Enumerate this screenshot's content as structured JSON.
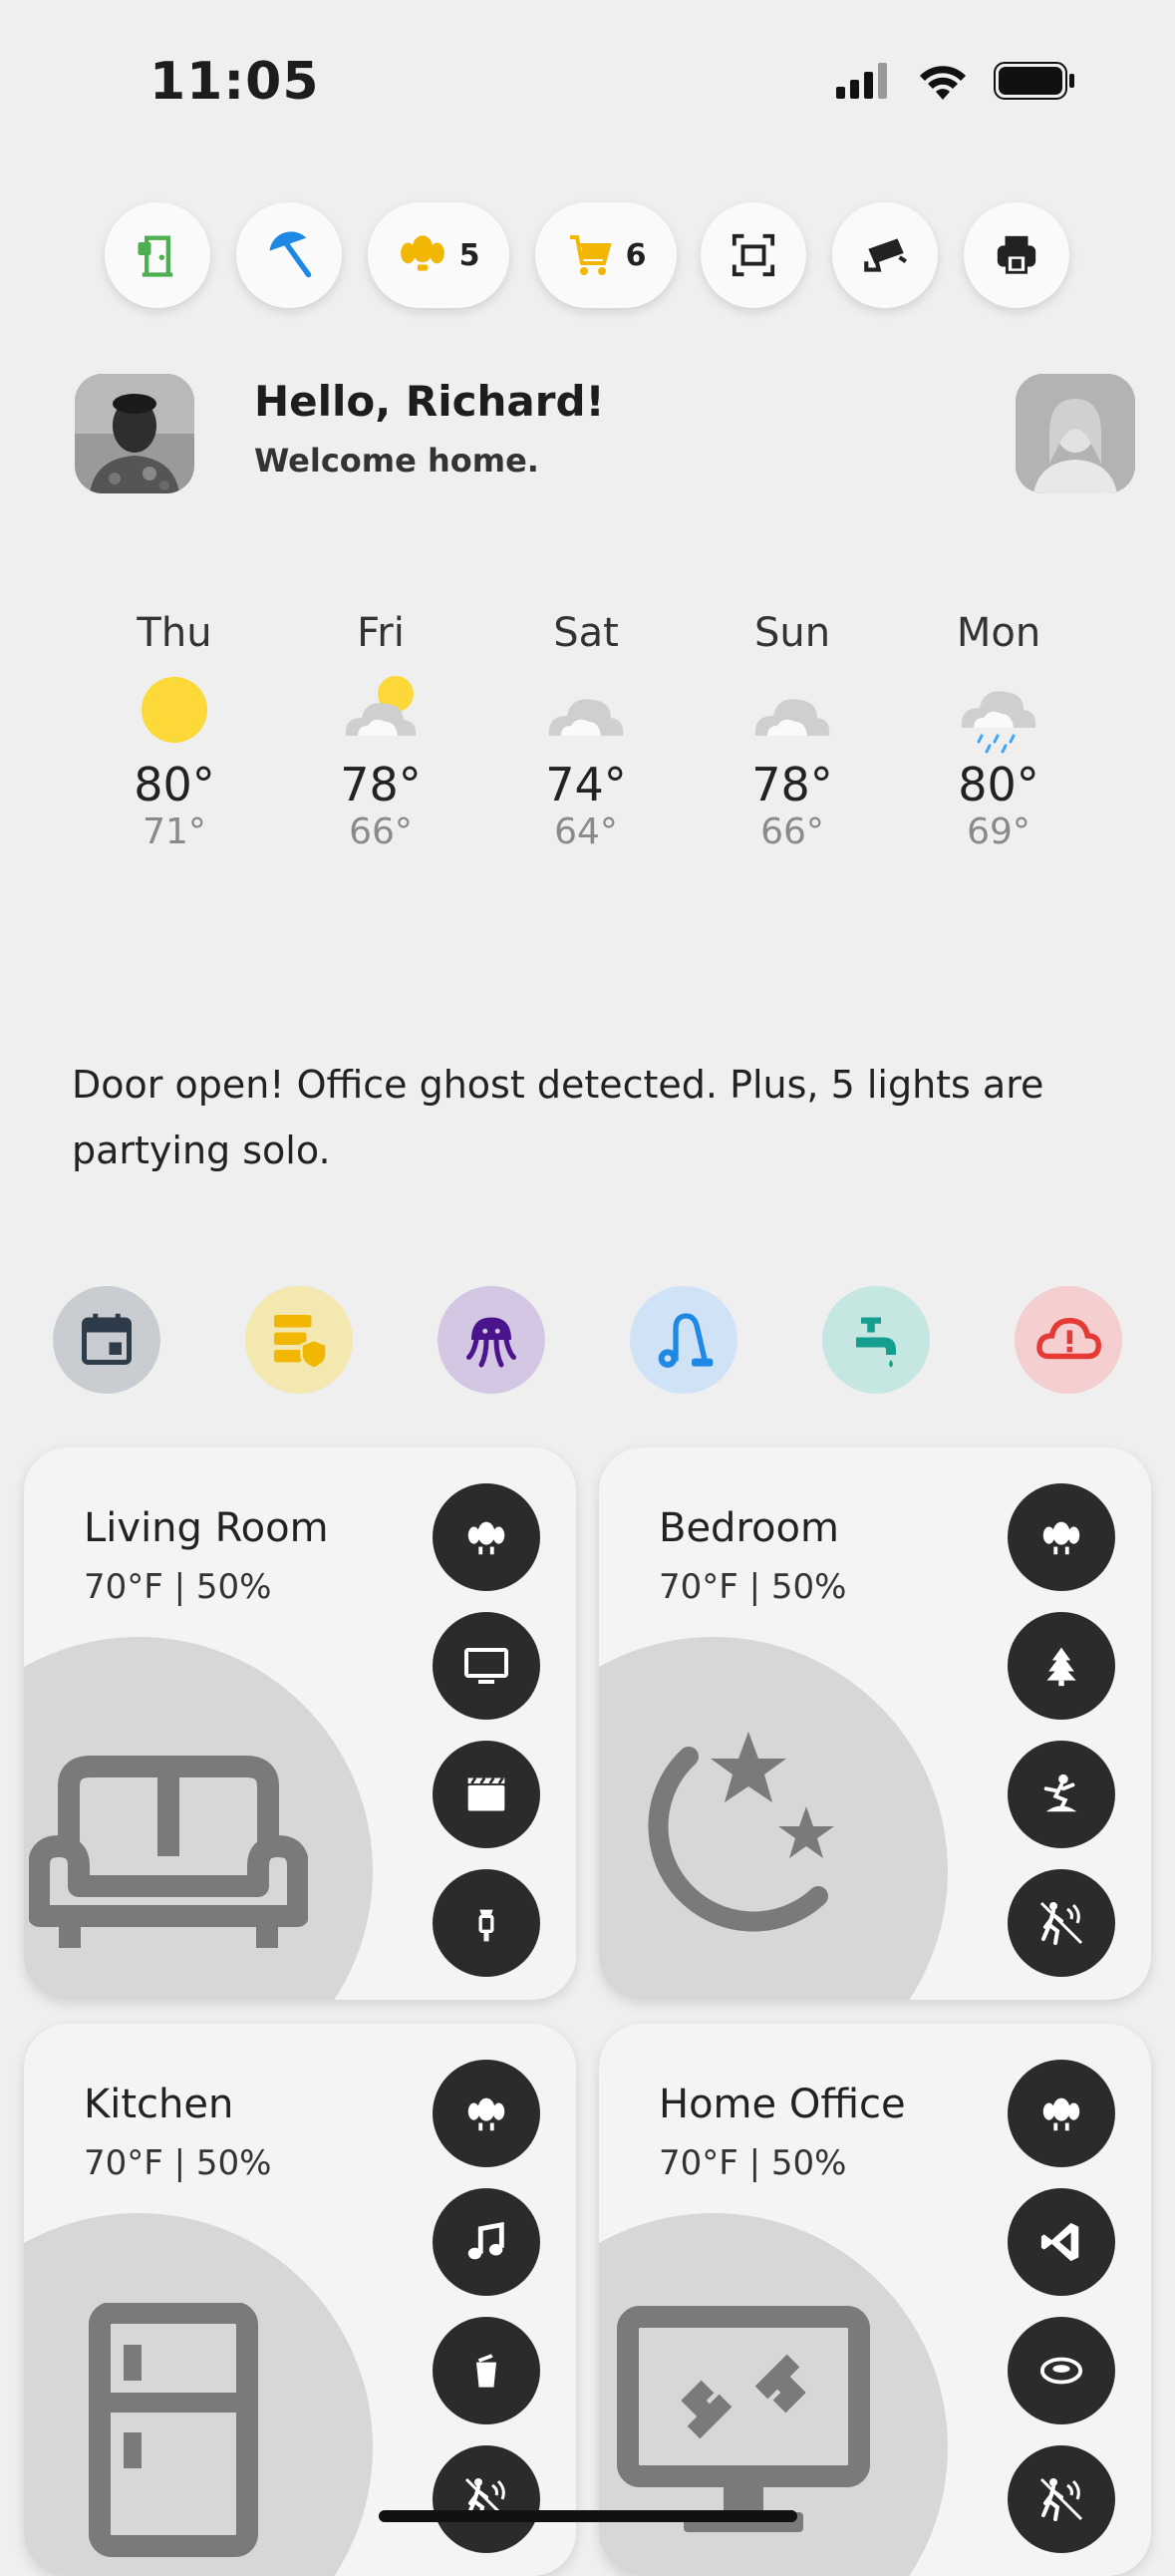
{
  "status_bar": {
    "time": "11:05",
    "icons": [
      "cellular-signal-icon",
      "wifi-icon",
      "battery-icon"
    ]
  },
  "chips": [
    {
      "icon": "door-open-icon",
      "color": "#4caf50",
      "count": ""
    },
    {
      "icon": "umbrella-icon",
      "color": "#1e88e5",
      "count": ""
    },
    {
      "icon": "lightbulb-group-icon",
      "color": "#f2b705",
      "count": "5"
    },
    {
      "icon": "shopping-cart-icon",
      "color": "#f2b705",
      "count": "6"
    },
    {
      "icon": "scan-icon",
      "color": "#222222",
      "count": ""
    },
    {
      "icon": "security-camera-icon",
      "color": "#222222",
      "count": ""
    },
    {
      "icon": "package-printer-icon",
      "color": "#222222",
      "count": ""
    }
  ],
  "greeting": {
    "title": "Hello, Richard!",
    "subtitle": "Welcome home."
  },
  "weather": [
    {
      "day": "Thu",
      "icon": "sunny-icon",
      "high": "80°",
      "low": "71°"
    },
    {
      "day": "Fri",
      "icon": "partly-cloudy-icon",
      "high": "78°",
      "low": "66°"
    },
    {
      "day": "Sat",
      "icon": "cloudy-icon",
      "high": "74°",
      "low": "64°"
    },
    {
      "day": "Sun",
      "icon": "cloudy-icon",
      "high": "78°",
      "low": "66°"
    },
    {
      "day": "Mon",
      "icon": "rainy-icon",
      "high": "80°",
      "low": "69°"
    }
  ],
  "message": "Door open! Office ghost detected. Plus, 5 lights are partying solo.",
  "apps": [
    {
      "icon": "calendar-icon",
      "bg": "#c9ccd0",
      "fg": "#2d3b4b"
    },
    {
      "icon": "server-shield-icon",
      "bg": "#f3e8b0",
      "fg": "#f2b705"
    },
    {
      "icon": "jellyfish-icon",
      "bg": "#d3c7e3",
      "fg": "#4a148c"
    },
    {
      "icon": "vacuum-icon",
      "bg": "#cfe2f6",
      "fg": "#1e88e5"
    },
    {
      "icon": "faucet-icon",
      "bg": "#c6e6e2",
      "fg": "#149e8f"
    },
    {
      "icon": "cloud-alert-icon",
      "bg": "#f5cfcf",
      "fg": "#e53935"
    }
  ],
  "rooms": [
    {
      "name": "Living Room",
      "climate": "70°F | 50%",
      "icon": "sofa-icon",
      "buttons": [
        "ceiling-light-icon",
        "tv-icon",
        "clapperboard-icon",
        "lantern-icon"
      ]
    },
    {
      "name": "Bedroom",
      "climate": "70°F | 50%",
      "icon": "moon-stars-icon",
      "buttons": [
        "ceiling-light-icon",
        "pine-tree-icon",
        "dance-icon",
        "motion-sensor-off-icon"
      ]
    },
    {
      "name": "Kitchen",
      "climate": "70°F | 50%",
      "icon": "fridge-icon",
      "buttons": [
        "ceiling-light-icon",
        "music-note-icon",
        "trash-can-icon",
        "motion-sensor-off-icon"
      ]
    },
    {
      "name": "Home Office",
      "climate": "70°F | 50%",
      "icon": "remote-desktop-icon",
      "buttons": [
        "ceiling-light-icon",
        "vscode-icon",
        "robot-vacuum-icon",
        "motion-sensor-off-icon"
      ]
    }
  ]
}
